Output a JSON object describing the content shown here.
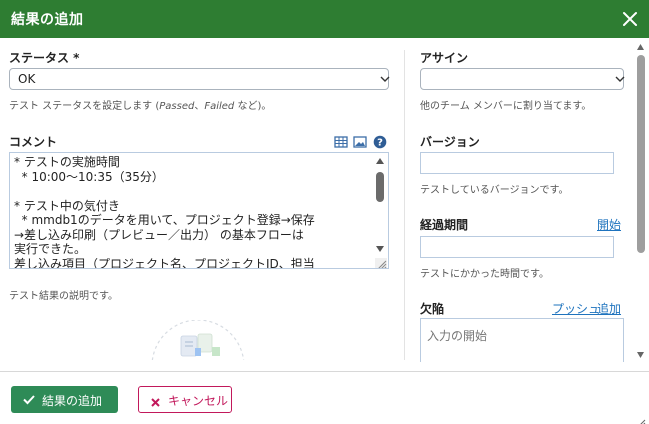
{
  "dialog": {
    "title": "結果の追加"
  },
  "status": {
    "label": "ステータス *",
    "value": "OK",
    "help_prefix": "テスト ステータスを設定します (",
    "help_passed": "Passed",
    "help_sep": "、",
    "help_failed": "Failed",
    "help_suffix": " など)。"
  },
  "comment": {
    "label": "コメント",
    "text": "* テストの実施時間\n  * 10:00～10:35（35分）\n\n* テスト中の気付き\n  * mmdb1のデータを用いて、プロジェクト登録→保存\n→差し込み印刷（プレビュー／出力） の基本フローは\n実行できた。\n差し込み項目（プロジェクト名、プロジェクトID、担当",
    "help": "テスト結果の説明です。"
  },
  "assign": {
    "label": "アサイン",
    "value": "",
    "help": "他のチーム メンバーに割り当てます。"
  },
  "version": {
    "label": "バージョン",
    "help": "テストしているバージョンです。"
  },
  "elapsed": {
    "label": "経過期間",
    "start_link": "開始",
    "help": "テストにかかった時間です。"
  },
  "defects": {
    "label": "欠陥",
    "push_link": "プッシュ",
    "add_link": "追加",
    "placeholder": "入力の開始"
  },
  "footer": {
    "submit_label": "結果の追加",
    "cancel_label": "キャンセル"
  },
  "colors": {
    "header": "#2e7d32",
    "primary": "#2e8b57",
    "cancel": "#c2185b",
    "link": "#1e73be"
  }
}
